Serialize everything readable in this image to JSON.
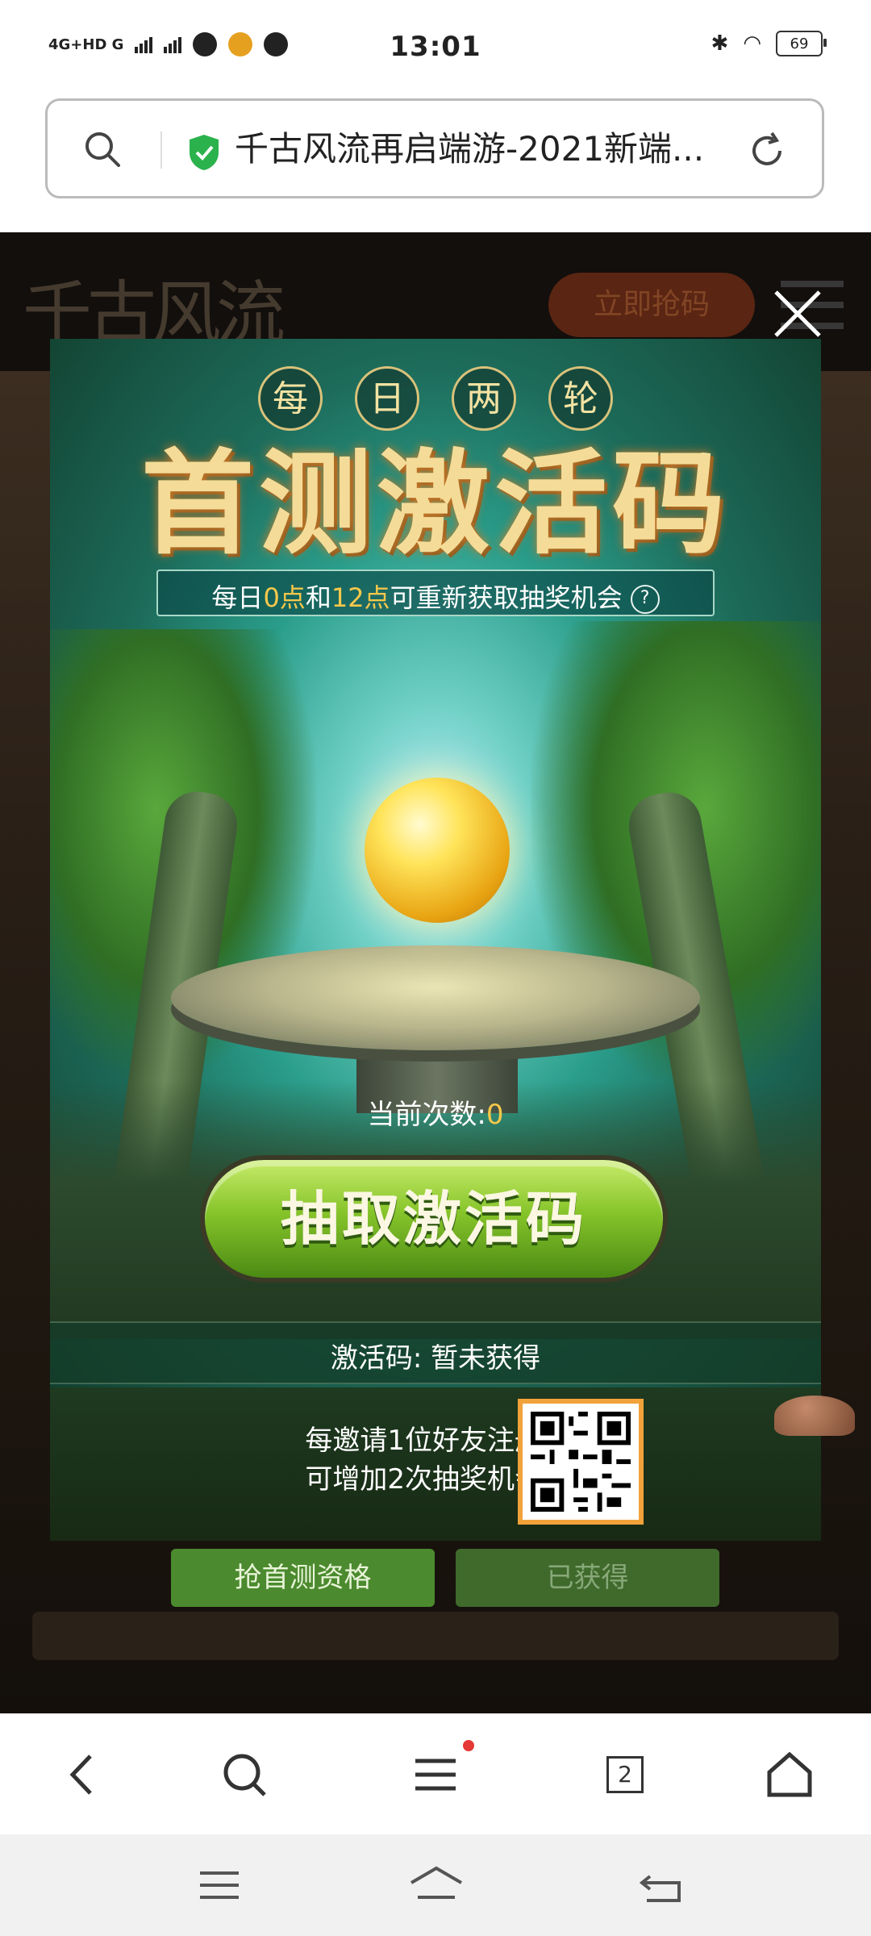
{
  "status": {
    "time": "13:01",
    "network": "4G+HD G",
    "battery": "69"
  },
  "address_bar": {
    "title": "千古风流再启端游-2021新端..."
  },
  "site": {
    "logo_text": "千古风流",
    "grab_button": "立即抢码",
    "bottom_tabs": [
      {
        "label": "抢首测资格",
        "state": "active"
      },
      {
        "label": "已获得",
        "state": "disabled"
      }
    ]
  },
  "modal": {
    "tag_chars": [
      "每",
      "日",
      "两",
      "轮"
    ],
    "title": "首测激活码",
    "subtitle_pre": "每日",
    "subtitle_h1": "0点",
    "subtitle_mid": "和",
    "subtitle_h2": "12点",
    "subtitle_post": "可重新获取抽奖机会",
    "help_icon": "?",
    "count_label": "当前次数:",
    "count_value": "0",
    "draw_button": "抽取激活码",
    "code_label": "激活码: 暂未获得",
    "invite_line1": "每邀请1位好友注册",
    "invite_line2": "可增加2次抽奖机会"
  },
  "toolbar": {
    "tab_count": "2"
  },
  "colors": {
    "accent_yellow": "#f7c84a",
    "green_button": "#86c42a",
    "qr_border": "#f2a23a",
    "notification_dot": "#e53935"
  }
}
